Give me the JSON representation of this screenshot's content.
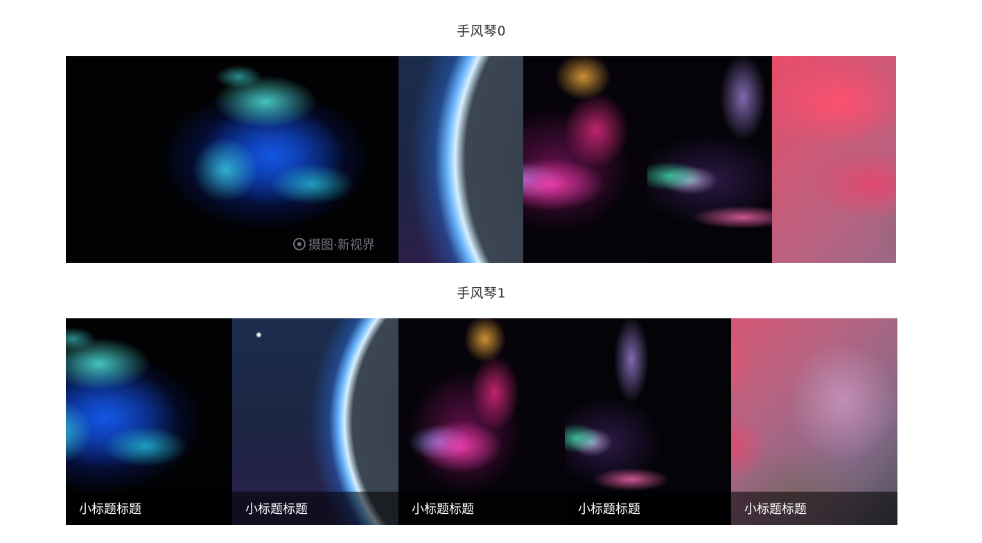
{
  "sections": [
    {
      "title": "手风琴0",
      "watermark": "摄图·新视界"
    },
    {
      "title": "手风琴1",
      "items": [
        {
          "caption": "小标题标题"
        },
        {
          "caption": "小标题标题"
        },
        {
          "caption": "小标题标题"
        },
        {
          "caption": "小标题标题"
        },
        {
          "caption": "小标题标题"
        }
      ]
    }
  ]
}
